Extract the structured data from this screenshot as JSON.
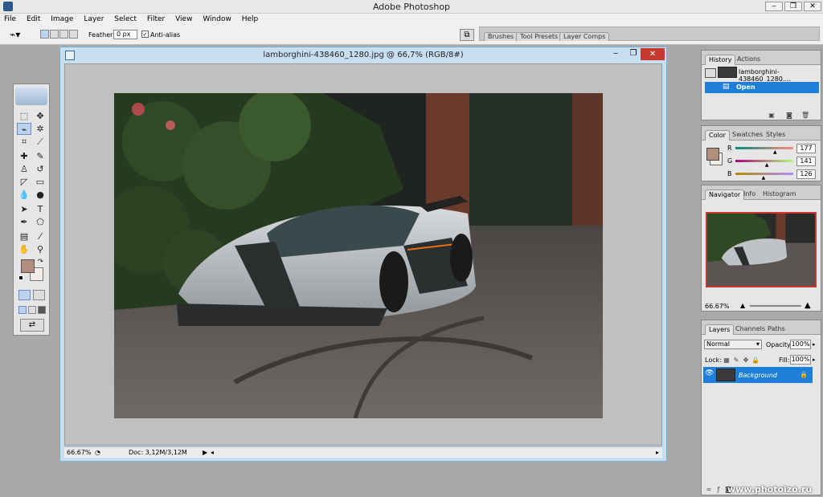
{
  "app": {
    "title": "Adobe Photoshop"
  },
  "window_buttons": {
    "minimize": "‒",
    "restore": "❐",
    "close": "✕"
  },
  "menu": [
    "File",
    "Edit",
    "Image",
    "Layer",
    "Select",
    "Filter",
    "View",
    "Window",
    "Help"
  ],
  "options": {
    "feather_label": "Feather:",
    "feather_value": "0 px",
    "antialias_label": "Anti-alias",
    "antialias_checked": true
  },
  "palette_well": [
    "Brushes",
    "Tool Presets",
    "Layer Comps"
  ],
  "document": {
    "title": "lamborghini-438460_1280.jpg @ 66,7% (RGB/8#)",
    "zoom": "66.67%",
    "doc_size": "Doc: 3,12M/3,12M"
  },
  "history_panel": {
    "tabs": [
      "History",
      "Actions"
    ],
    "snapshot": "lamborghini-438460_1280....",
    "item": "Open"
  },
  "color_panel": {
    "tabs": [
      "Color",
      "Swatches",
      "Styles"
    ],
    "r_label": "R",
    "g_label": "G",
    "b_label": "B",
    "r": "177",
    "g": "141",
    "b": "126",
    "r_level": 0.694,
    "g_level": 0.553,
    "b_level": 0.494,
    "foreground": "#b18d7e",
    "background": "#f1ece7"
  },
  "navigator_panel": {
    "tabs": [
      "Navigator",
      "Info",
      "Histogram"
    ],
    "zoom": "66.67%"
  },
  "layers_panel": {
    "tabs": [
      "Layers",
      "Channels",
      "Paths"
    ],
    "blend_mode": "Normal",
    "opacity_label": "Opacity:",
    "opacity": "100%",
    "lock_label": "Lock:",
    "fill_label": "Fill:",
    "fill": "100%",
    "layer_name": "Background"
  },
  "watermark": {
    "text": "www.photoizo.ru"
  },
  "colors": {
    "selection": "#1e7fd8",
    "accent": "#2a7fd4"
  }
}
